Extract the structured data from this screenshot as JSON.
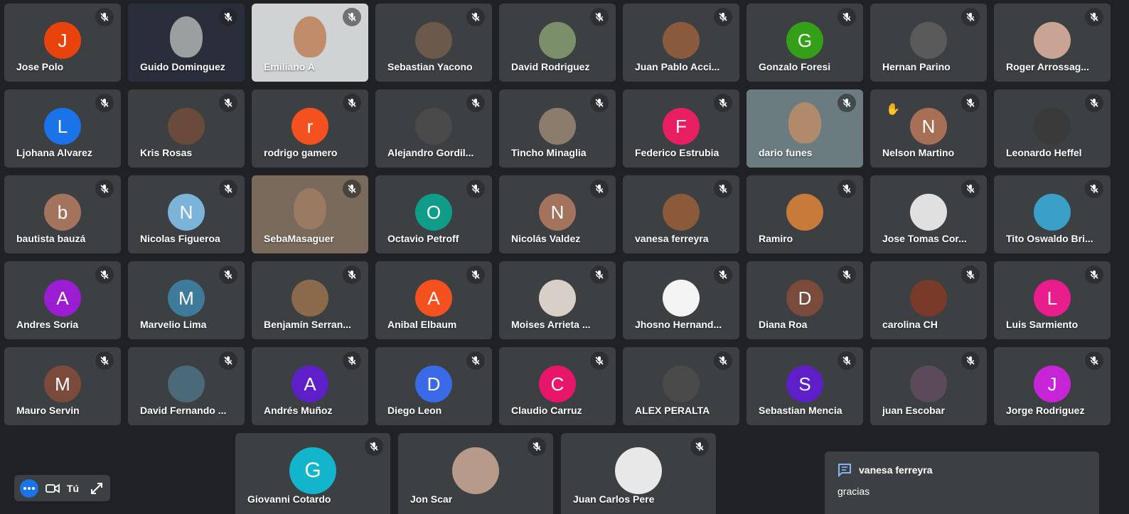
{
  "participants": [
    {
      "name": "Jose Polo",
      "initial": "J",
      "color": "#e8430c"
    },
    {
      "name": "Guido Dominguez",
      "video": true,
      "bg": "#2a2d3a",
      "face": "#9aa0a0"
    },
    {
      "name": "Emiliano A",
      "video": true,
      "bg": "#cfd3d3",
      "face": "#c08c6a"
    },
    {
      "name": "Sebastian Yacono",
      "photo": "#6b5a4c"
    },
    {
      "name": "David Rodriguez",
      "photo": "#7a8f6a"
    },
    {
      "name": "Juan Pablo Acci...",
      "photo": "#8a5a3c"
    },
    {
      "name": "Gonzalo Foresi",
      "initial": "G",
      "color": "#34a017"
    },
    {
      "name": "Hernan Parino",
      "photo": "#5a5a5a"
    },
    {
      "name": "Roger Arrossag...",
      "photo": "#c9a394"
    },
    {
      "name": "Ljohana Alvarez",
      "initial": "L",
      "color": "#1a73e8"
    },
    {
      "name": "Kris Rosas",
      "photo": "#6a4a3a"
    },
    {
      "name": "rodrigo gamero",
      "initial": "r",
      "color": "#f4511e"
    },
    {
      "name": "Alejandro Gordil...",
      "photo": "#4a4a4a"
    },
    {
      "name": "Tincho Minaglia",
      "photo": "#8c7c6c"
    },
    {
      "name": "Federico Estrubia",
      "initial": "F",
      "color": "#e91e63"
    },
    {
      "name": "dario funes",
      "video": true,
      "bg": "#6a7c80",
      "face": "#b08a6a"
    },
    {
      "name": "Nelson Martino",
      "initial": "N",
      "color": "#a86f57",
      "hand": true
    },
    {
      "name": "Leonardo Heffel",
      "photo": "#3a3a3a"
    },
    {
      "name": "bautista bauzá",
      "initial": "b",
      "color": "#a4735d"
    },
    {
      "name": "Nicolas Figueroa",
      "initial": "N",
      "color": "#7cb3d8"
    },
    {
      "name": "SebaMasaguer",
      "video": true,
      "bg": "#7a6a5c",
      "face": "#9a7a60"
    },
    {
      "name": "Octavio Petroff",
      "initial": "O",
      "color": "#0f9d8a"
    },
    {
      "name": "Nicolás Valdez",
      "initial": "N",
      "color": "#a4735d"
    },
    {
      "name": "vanesa ferreyra",
      "photo": "#8a5a3a"
    },
    {
      "name": "Ramiro",
      "photo": "#c87a3a"
    },
    {
      "name": "Jose Tomas Cor...",
      "photo": "#e0e0e0"
    },
    {
      "name": "Tito Oswaldo Bri...",
      "photo": "#3aa0c8"
    },
    {
      "name": "Andres Soria",
      "initial": "A",
      "color": "#9c1cd1"
    },
    {
      "name": "Marvelio Lima",
      "initial": "M",
      "color": "#3e7a9a"
    },
    {
      "name": "Benjamín Serran...",
      "photo": "#8a6a4a"
    },
    {
      "name": "Anibal Elbaum",
      "initial": "A",
      "color": "#f4511e"
    },
    {
      "name": "Moises Arrieta ...",
      "photo": "#d8d0c8"
    },
    {
      "name": "Jhosno Hernand...",
      "photo": "#f4f4f4"
    },
    {
      "name": "Diana Roa",
      "initial": "D",
      "color": "#7a4a3a"
    },
    {
      "name": "carolina CH",
      "photo": "#7a3a2a"
    },
    {
      "name": "Luis Sarmiento",
      "initial": "L",
      "color": "#e91e8c"
    },
    {
      "name": "Mauro Servin",
      "initial": "M",
      "color": "#7a4a3a"
    },
    {
      "name": "David Fernando ...",
      "photo": "#4a6a7a"
    },
    {
      "name": "Andrés Muñoz",
      "initial": "A",
      "color": "#5e1fc9"
    },
    {
      "name": "Diego Leon",
      "initial": "D",
      "color": "#3a6ae8"
    },
    {
      "name": "Claudio Carruz",
      "initial": "C",
      "color": "#e8166b"
    },
    {
      "name": "ALEX PERALTA",
      "photo": "#4a4a4a"
    },
    {
      "name": "Sebastian Mencia",
      "initial": "S",
      "color": "#5e1fc9"
    },
    {
      "name": "juan Escobar",
      "photo": "#5a4a5a"
    },
    {
      "name": "Jorge Rodriguez",
      "initial": "J",
      "color": "#c724d8"
    }
  ],
  "bottom_participants": [
    {
      "name": "Giovanni Cotardo",
      "initial": "G",
      "color": "#12b5cb"
    },
    {
      "name": "Jon Scar",
      "photo": "#b89a8a"
    },
    {
      "name": "Juan Carlos Pere",
      "photo": "#e8e8e8"
    }
  ],
  "self_controls": {
    "label": "Tú"
  },
  "chat": {
    "sender": "vanesa ferreyra",
    "message": "gracias"
  },
  "colors": {
    "background": "#202124",
    "tile": "#3c4043",
    "accent": "#1a73e8",
    "chat_icon": "#8ab4f8"
  }
}
